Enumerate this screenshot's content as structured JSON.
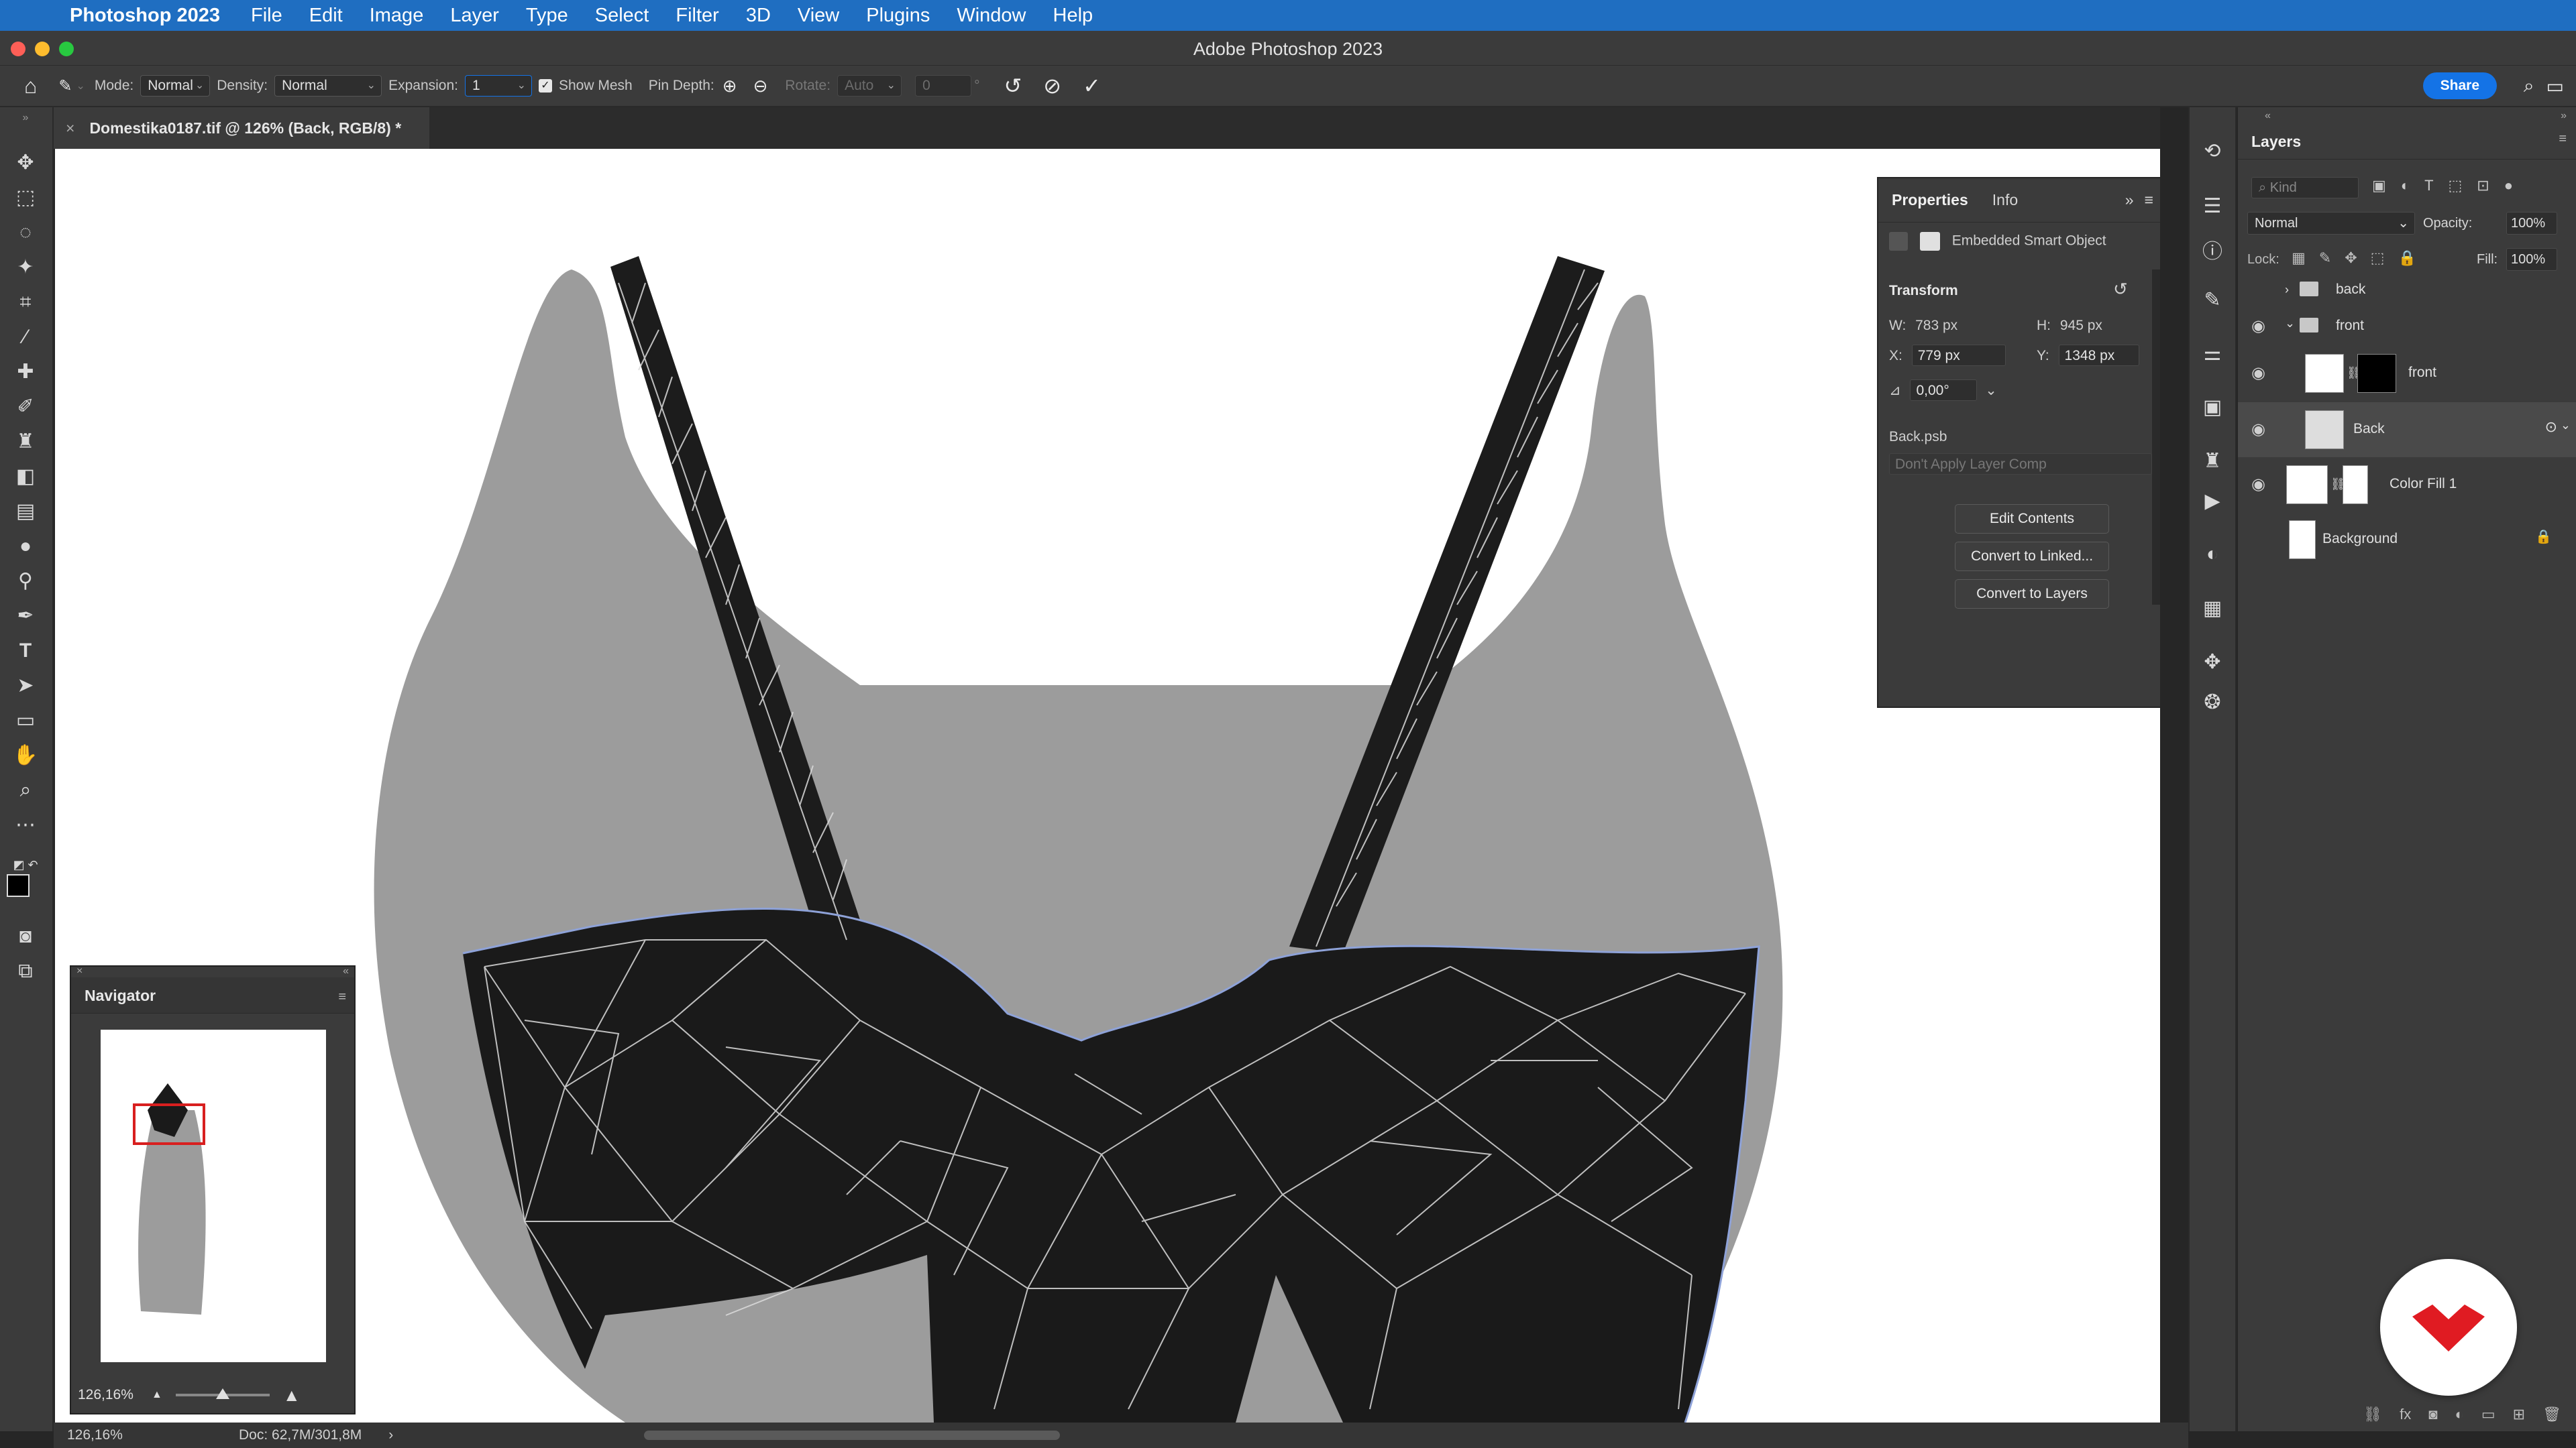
{
  "menubar": {
    "app": "Photoshop 2023",
    "items": [
      "File",
      "Edit",
      "Image",
      "Layer",
      "Type",
      "Select",
      "Filter",
      "3D",
      "View",
      "Plugins",
      "Window",
      "Help"
    ]
  },
  "window": {
    "title": "Adobe Photoshop 2023"
  },
  "options": {
    "mode_label": "Mode:",
    "mode_value": "Normal",
    "density_label": "Density:",
    "density_value": "Normal",
    "expansion_label": "Expansion:",
    "expansion_value": "1",
    "show_mesh_label": "Show Mesh",
    "show_mesh_checked": true,
    "pin_depth_label": "Pin Depth:",
    "rotate_label": "Rotate:",
    "rotate_value": "Auto",
    "rotate_angle": "0",
    "degree": "°",
    "share_label": "Share"
  },
  "document": {
    "tab_title": "Domestika0187.tif @ 126% (Back, RGB/8) *"
  },
  "navigator": {
    "title": "Navigator",
    "zoom": "126,16%"
  },
  "properties": {
    "tabs": [
      "Properties",
      "Info"
    ],
    "type": "Embedded Smart Object",
    "section": "Transform",
    "w_label": "W:",
    "w_value": "783 px",
    "h_label": "H:",
    "h_value": "945 px",
    "x_label": "X:",
    "x_value": "779 px",
    "y_label": "Y:",
    "y_value": "1348 px",
    "angle": "0,00°",
    "file": "Back.psb",
    "layer_comp": "Don't Apply Layer Comp",
    "buttons": [
      "Edit Contents",
      "Convert to Linked...",
      "Convert to Layers"
    ]
  },
  "layers": {
    "title": "Layers",
    "kind": "Kind",
    "blend": "Normal",
    "opacity_label": "Opacity:",
    "opacity": "100%",
    "lock_label": "Lock:",
    "fill_label": "Fill:",
    "fill": "100%",
    "items": [
      {
        "name": "back",
        "kind": "group",
        "expanded": false
      },
      {
        "name": "front",
        "kind": "group",
        "expanded": true
      },
      {
        "name": "front",
        "kind": "layer"
      },
      {
        "name": "Back",
        "kind": "smart",
        "selected": true
      },
      {
        "name": "Color Fill 1",
        "kind": "fill"
      },
      {
        "name": "Background",
        "kind": "background"
      }
    ]
  },
  "status": {
    "zoom": "126,16%",
    "doc": "Doc: 62,7M/301,8M"
  },
  "colors": {
    "menubar": "#1f6ec1",
    "accent": "#1473e6",
    "mesh": "#dcdcdc",
    "garment_dark": "#1a1a1a",
    "garment_back": "#9c9c9c"
  }
}
